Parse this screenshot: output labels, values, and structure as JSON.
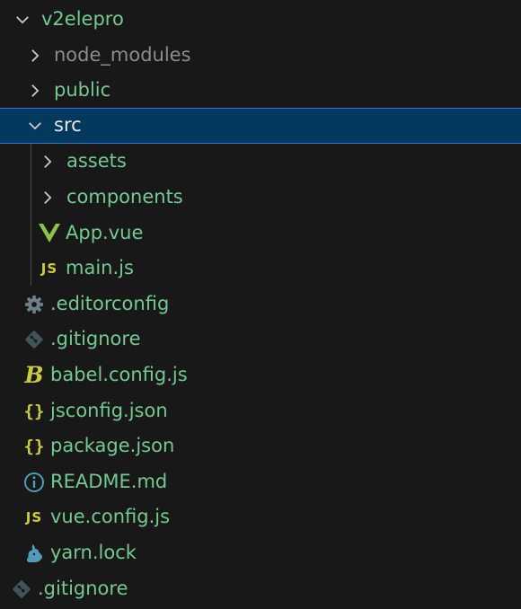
{
  "explorer": {
    "root": {
      "label": "v2elepro",
      "expanded": true
    },
    "items": [
      {
        "label": "node_modules",
        "type": "folder",
        "expanded": false
      },
      {
        "label": "public",
        "type": "folder",
        "expanded": false
      },
      {
        "label": "src",
        "type": "folder",
        "expanded": true,
        "selected": true
      },
      {
        "label": "assets",
        "type": "folder",
        "expanded": false
      },
      {
        "label": "components",
        "type": "folder",
        "expanded": false
      },
      {
        "label": "App.vue",
        "type": "file",
        "icon": "vue-icon"
      },
      {
        "label": "main.js",
        "type": "file",
        "icon": "js-icon",
        "icon_text": "JS"
      },
      {
        "label": ".editorconfig",
        "type": "file",
        "icon": "gear-icon"
      },
      {
        "label": ".gitignore",
        "type": "file",
        "icon": "git-icon"
      },
      {
        "label": "babel.config.js",
        "type": "file",
        "icon": "babel-icon",
        "icon_text": "B"
      },
      {
        "label": "jsconfig.json",
        "type": "file",
        "icon": "json-icon",
        "icon_text": "{}"
      },
      {
        "label": "package.json",
        "type": "file",
        "icon": "json-icon",
        "icon_text": "{}"
      },
      {
        "label": "README.md",
        "type": "file",
        "icon": "info-icon"
      },
      {
        "label": "vue.config.js",
        "type": "file",
        "icon": "js-icon",
        "icon_text": "JS"
      },
      {
        "label": "yarn.lock",
        "type": "file",
        "icon": "yarn-icon"
      },
      {
        "label": ".gitignore",
        "type": "file",
        "icon": "git-icon"
      }
    ]
  },
  "colors": {
    "background": "#181818",
    "label_untracked": "#73c991",
    "label_ignored": "#8c8c8c",
    "selection": "#04395e",
    "selection_border": "#2b79d8",
    "icon_yellow": "#cbcb41",
    "icon_vue": "#8dc149",
    "icon_blue": "#519aba",
    "icon_gray": "#6d8086"
  }
}
